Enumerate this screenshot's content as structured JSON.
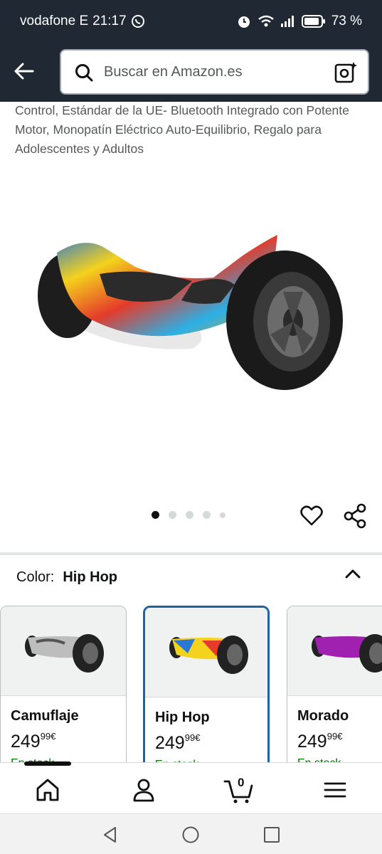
{
  "status_bar": {
    "carrier": "vodafone E",
    "time": "21:17",
    "battery": "73 %"
  },
  "search": {
    "placeholder": "Buscar en Amazon.es"
  },
  "product": {
    "title": "Control, Estándar de la UE- Bluetooth Integrado con Potente Motor, Monopatín Eléctrico Auto-Equilibrio, Regalo para Adolescentes y Adultos",
    "image_icon": "hoverboard-image",
    "carousel_active_index": 0,
    "carousel_count": 5
  },
  "color": {
    "label": "Color:",
    "selected": "Hip Hop"
  },
  "swatches": [
    {
      "name": "Camuflaje",
      "price_whole": "249",
      "price_fraction": "99",
      "currency": "€",
      "stock": "En stock"
    },
    {
      "name": "Hip Hop",
      "price_whole": "249",
      "price_fraction": "99",
      "currency": "€",
      "stock": "En stock"
    },
    {
      "name": "Morado",
      "price_whole": "249",
      "price_fraction": "99",
      "currency": "€",
      "stock": "En stock"
    }
  ],
  "cart": {
    "count": "0"
  },
  "colors": {
    "header_bg": "#1f2833",
    "selected_border": "#2162a1",
    "stock_green": "#007600"
  }
}
